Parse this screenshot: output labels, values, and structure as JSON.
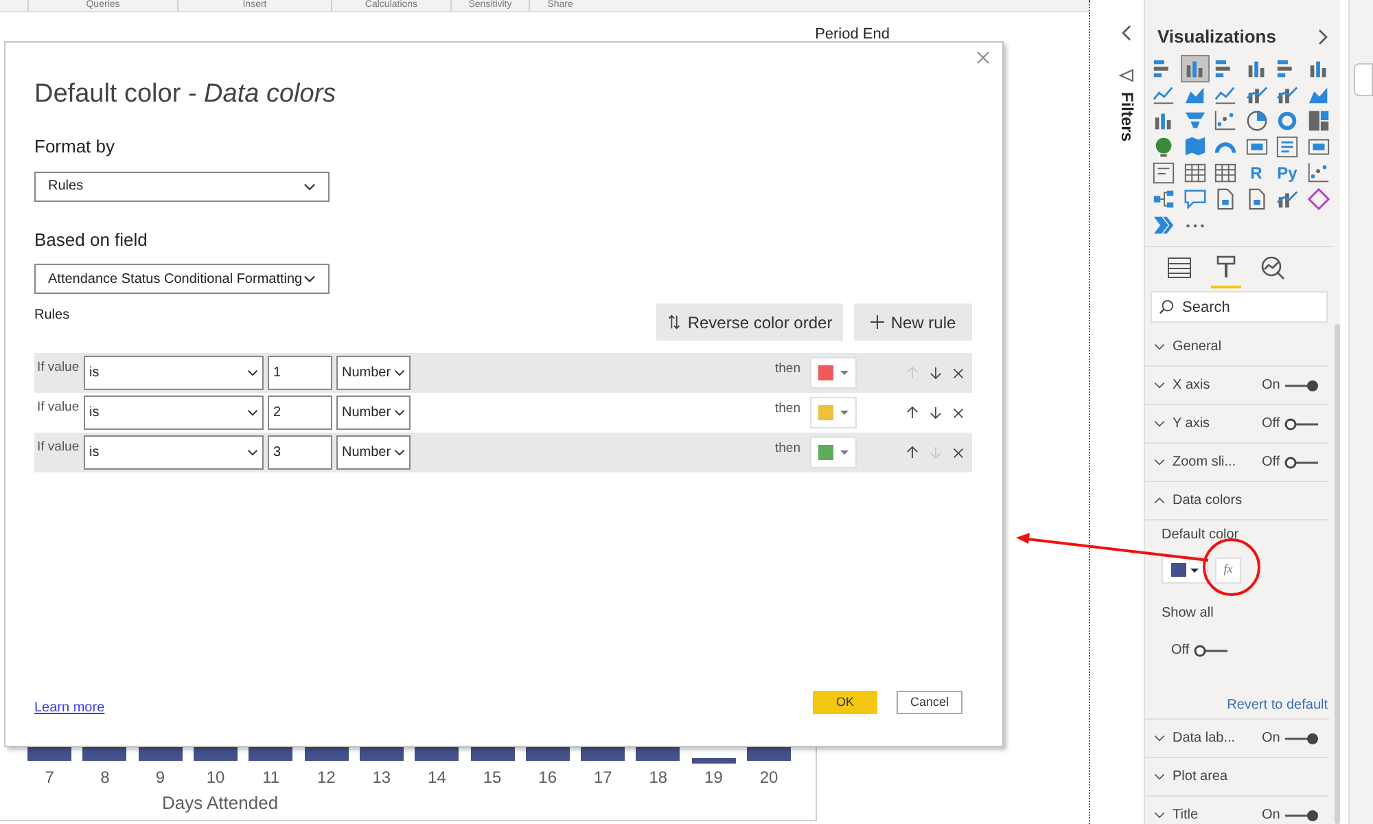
{
  "ribbon": {
    "groups": [
      "Queries",
      "Insert",
      "Calculations",
      "Sensitivity",
      "Share"
    ]
  },
  "canvas": {
    "visual_title": "Period End",
    "x_labels": [
      {
        "label": "7",
        "kind": "full"
      },
      {
        "label": "8",
        "kind": "full"
      },
      {
        "label": "9",
        "kind": "full"
      },
      {
        "label": "10",
        "kind": "full"
      },
      {
        "label": "11",
        "kind": "full"
      },
      {
        "label": "12",
        "kind": "full"
      },
      {
        "label": "13",
        "kind": "full"
      },
      {
        "label": "14",
        "kind": "full"
      },
      {
        "label": "15",
        "kind": "full"
      },
      {
        "label": "16",
        "kind": "full"
      },
      {
        "label": "17",
        "kind": "full"
      },
      {
        "label": "18",
        "kind": "full"
      },
      {
        "label": "19",
        "kind": "low"
      },
      {
        "label": "20",
        "kind": "full"
      }
    ],
    "x_axis_title": "Days Attended"
  },
  "dialog": {
    "title": "Default color - *Data colors*",
    "format_by": {
      "label": "Format by",
      "value": "Rules"
    },
    "based_on_field": {
      "label": "Based on field",
      "value": "Attendance Status Conditional Formatting"
    },
    "rules_label": "Rules",
    "buttons": [
      {
        "kind": "reverse",
        "label": "Reverse color order"
      },
      {
        "kind": "new",
        "label": "New rule"
      }
    ],
    "rules": [
      {
        "prefix": "If value",
        "operator": "is",
        "value": "1",
        "type": "Number",
        "then": "then",
        "color": "#f0595a",
        "up_disabled": true,
        "down_disabled": false
      },
      {
        "prefix": "If value",
        "operator": "is",
        "value": "2",
        "type": "Number",
        "then": "then",
        "color": "#edc13b",
        "up_disabled": false,
        "down_disabled": false
      },
      {
        "prefix": "If value",
        "operator": "is",
        "value": "3",
        "type": "Number",
        "then": "then",
        "color": "#5dac59",
        "up_disabled": false,
        "down_disabled": true
      }
    ],
    "learn_more": "Learn more",
    "ok": "OK",
    "cancel": "Cancel"
  },
  "filters": {
    "title": "Filters"
  },
  "visualizations": {
    "title": "Visualizations",
    "types": [
      {
        "kind": "hbar",
        "selected": false
      },
      {
        "kind": "col",
        "selected": true
      },
      {
        "kind": "hbar",
        "selected": false
      },
      {
        "kind": "col",
        "selected": false
      },
      {
        "kind": "hbar",
        "selected": false
      },
      {
        "kind": "col",
        "selected": false
      },
      {
        "kind": "line",
        "selected": false
      },
      {
        "kind": "area",
        "selected": false
      },
      {
        "kind": "line",
        "selected": false
      },
      {
        "kind": "combo",
        "selected": false
      },
      {
        "kind": "combo",
        "selected": false
      },
      {
        "kind": "area",
        "selected": false
      },
      {
        "kind": "col",
        "selected": false
      },
      {
        "kind": "funnel",
        "selected": false
      },
      {
        "kind": "scatter",
        "selected": false
      },
      {
        "kind": "pie",
        "selected": false
      },
      {
        "kind": "donut",
        "selected": false
      },
      {
        "kind": "treemap",
        "selected": false
      },
      {
        "kind": "globe",
        "selected": false
      },
      {
        "kind": "map",
        "selected": false
      },
      {
        "kind": "gauge",
        "selected": false
      },
      {
        "kind": "card",
        "selected": false
      },
      {
        "kind": "text",
        "selected": false
      },
      {
        "kind": "card",
        "selected": false
      },
      {
        "kind": "slicer",
        "selected": false
      },
      {
        "kind": "table",
        "selected": false
      },
      {
        "kind": "table",
        "selected": false
      },
      {
        "kind": "glyph",
        "glyph": "R",
        "selected": false
      },
      {
        "kind": "glyph",
        "glyph": "Py",
        "selected": false
      },
      {
        "kind": "scatter",
        "selected": false
      },
      {
        "kind": "tree",
        "selected": false
      },
      {
        "kind": "bubble",
        "selected": false
      },
      {
        "kind": "doc",
        "selected": false
      },
      {
        "kind": "doc",
        "selected": false
      },
      {
        "kind": "combo",
        "selected": false
      },
      {
        "kind": "diamond",
        "selected": false
      },
      {
        "kind": "chevron",
        "selected": false
      },
      {
        "kind": "more",
        "selected": false
      }
    ],
    "tabs": [
      {
        "kind": "fields",
        "selected": false
      },
      {
        "kind": "format",
        "selected": true
      },
      {
        "kind": "analytics",
        "selected": false
      }
    ],
    "search_placeholder": "Search",
    "sections": [
      {
        "label": "General",
        "expanded": false
      },
      {
        "label": "X axis",
        "expanded": false,
        "toggle": "On",
        "on": true
      },
      {
        "label": "Y axis",
        "expanded": false,
        "toggle": "Off",
        "on": false
      },
      {
        "label": "Zoom sli...",
        "expanded": false,
        "toggle": "Off",
        "on": false
      },
      {
        "label": "Data colors",
        "expanded": true,
        "content": {
          "default_color_label": "Default color",
          "color": "#44518a",
          "fx": "fx",
          "show_all_label": "Show all",
          "show_all_toggle": "Off",
          "show_all_on": false,
          "revert": "Revert to default"
        }
      },
      {
        "label": "Data lab...",
        "expanded": false,
        "toggle": "On",
        "on": true
      },
      {
        "label": "Plot area",
        "expanded": false
      },
      {
        "label": "Title",
        "expanded": false,
        "toggle": "On",
        "on": true
      }
    ]
  }
}
